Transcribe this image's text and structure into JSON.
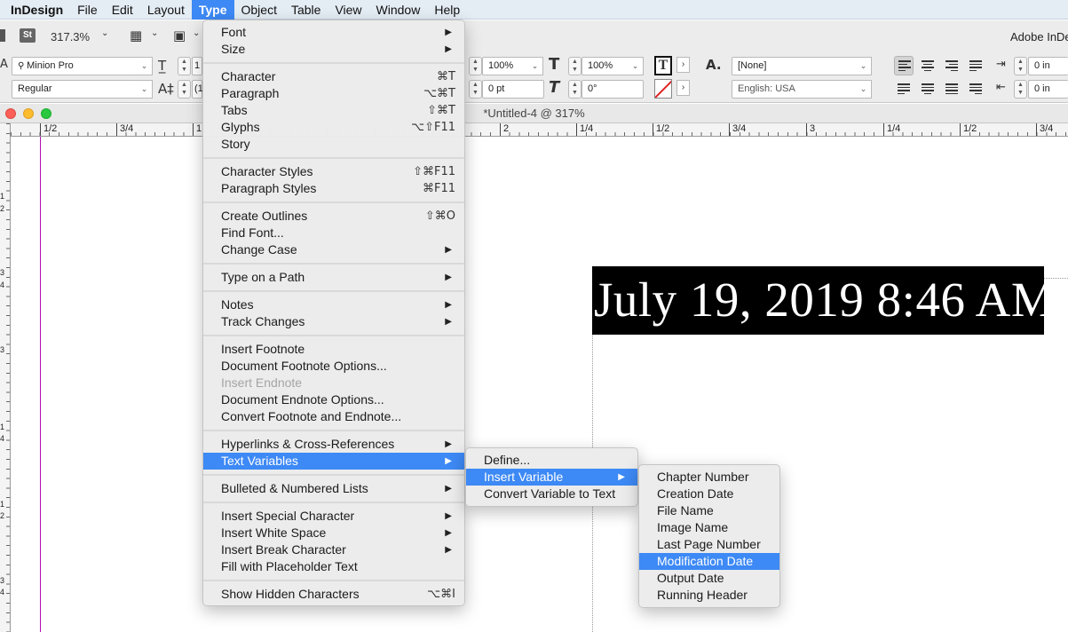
{
  "menubar": {
    "items": [
      "InDesign",
      "File",
      "Edit",
      "Layout",
      "Type",
      "Object",
      "Table",
      "View",
      "Window",
      "Help"
    ],
    "open_item": "Type"
  },
  "controlbar": {
    "zoom": "317.3%",
    "bridge_badge": "St",
    "font_family": "Minion Pro",
    "font_style": "Regular",
    "font_size_partial": "1",
    "leading_partial": "(1",
    "vscale": "100%",
    "hscale": "100%",
    "tracking": "0 pt",
    "skew": "0°",
    "char_style": "[None]",
    "language": "English: USA",
    "left_indent": "0 in",
    "first_indent": "0 in",
    "app_name_partial": "Adobe InDe"
  },
  "document": {
    "title": "*Untitled-4 @ 317%",
    "ruler_labels": [
      "1/2",
      "3/4",
      "1",
      "2",
      "1/4",
      "1/2",
      "3/4",
      "3",
      "1/4",
      "1/2",
      "3/4"
    ],
    "vruler_labels": [
      "1",
      "2",
      "3",
      "4",
      "3",
      "1",
      "4",
      "1",
      "2",
      "3",
      "4"
    ],
    "text_frame_content": "July 19, 2019 8:46 AM"
  },
  "type_menu": {
    "sections": [
      [
        {
          "label": "Font",
          "shortcut": "",
          "submenu": true
        },
        {
          "label": "Size",
          "shortcut": "",
          "submenu": true
        }
      ],
      [
        {
          "label": "Character",
          "shortcut": "⌘T",
          "submenu": false
        },
        {
          "label": "Paragraph",
          "shortcut": "⌥⌘T",
          "submenu": false
        },
        {
          "label": "Tabs",
          "shortcut": "⇧⌘T",
          "submenu": false
        },
        {
          "label": "Glyphs",
          "shortcut": "⌥⇧F11",
          "submenu": false
        },
        {
          "label": "Story",
          "shortcut": "",
          "submenu": false
        }
      ],
      [
        {
          "label": "Character Styles",
          "shortcut": "⇧⌘F11",
          "submenu": false
        },
        {
          "label": "Paragraph Styles",
          "shortcut": "⌘F11",
          "submenu": false
        }
      ],
      [
        {
          "label": "Create Outlines",
          "shortcut": "⇧⌘O",
          "submenu": false
        },
        {
          "label": "Find Font...",
          "shortcut": "",
          "submenu": false
        },
        {
          "label": "Change Case",
          "shortcut": "",
          "submenu": true
        }
      ],
      [
        {
          "label": "Type on a Path",
          "shortcut": "",
          "submenu": true
        }
      ],
      [
        {
          "label": "Notes",
          "shortcut": "",
          "submenu": true
        },
        {
          "label": "Track Changes",
          "shortcut": "",
          "submenu": true
        }
      ],
      [
        {
          "label": "Insert Footnote",
          "shortcut": "",
          "submenu": false
        },
        {
          "label": "Document Footnote Options...",
          "shortcut": "",
          "submenu": false
        },
        {
          "label": "Insert Endnote",
          "shortcut": "",
          "submenu": false,
          "disabled": true
        },
        {
          "label": "Document Endnote Options...",
          "shortcut": "",
          "submenu": false
        },
        {
          "label": "Convert Footnote and Endnote...",
          "shortcut": "",
          "submenu": false
        }
      ],
      [
        {
          "label": "Hyperlinks & Cross-References",
          "shortcut": "",
          "submenu": true
        },
        {
          "label": "Text Variables",
          "shortcut": "",
          "submenu": true,
          "selected": true
        }
      ],
      [
        {
          "label": "Bulleted & Numbered Lists",
          "shortcut": "",
          "submenu": true
        }
      ],
      [
        {
          "label": "Insert Special Character",
          "shortcut": "",
          "submenu": true
        },
        {
          "label": "Insert White Space",
          "shortcut": "",
          "submenu": true
        },
        {
          "label": "Insert Break Character",
          "shortcut": "",
          "submenu": true
        },
        {
          "label": "Fill with Placeholder Text",
          "shortcut": "",
          "submenu": false
        }
      ],
      [
        {
          "label": "Show Hidden Characters",
          "shortcut": "⌥⌘I",
          "submenu": false
        }
      ]
    ]
  },
  "text_variables_menu": {
    "items": [
      {
        "label": "Define...",
        "submenu": false
      },
      {
        "label": "Insert Variable",
        "submenu": true,
        "selected": true
      },
      {
        "label": "Convert Variable to Text",
        "submenu": false
      }
    ]
  },
  "insert_variable_menu": {
    "items": [
      {
        "label": "Chapter Number"
      },
      {
        "label": "Creation Date"
      },
      {
        "label": "File Name"
      },
      {
        "label": "Image Name"
      },
      {
        "label": "Last Page Number"
      },
      {
        "label": "Modification Date",
        "selected": true
      },
      {
        "label": "Output Date"
      },
      {
        "label": "Running Header"
      }
    ]
  },
  "colors": {
    "selection": "#3d89f5",
    "margin_guide": "#b10cb1",
    "text_frame_fill": "#000000"
  }
}
